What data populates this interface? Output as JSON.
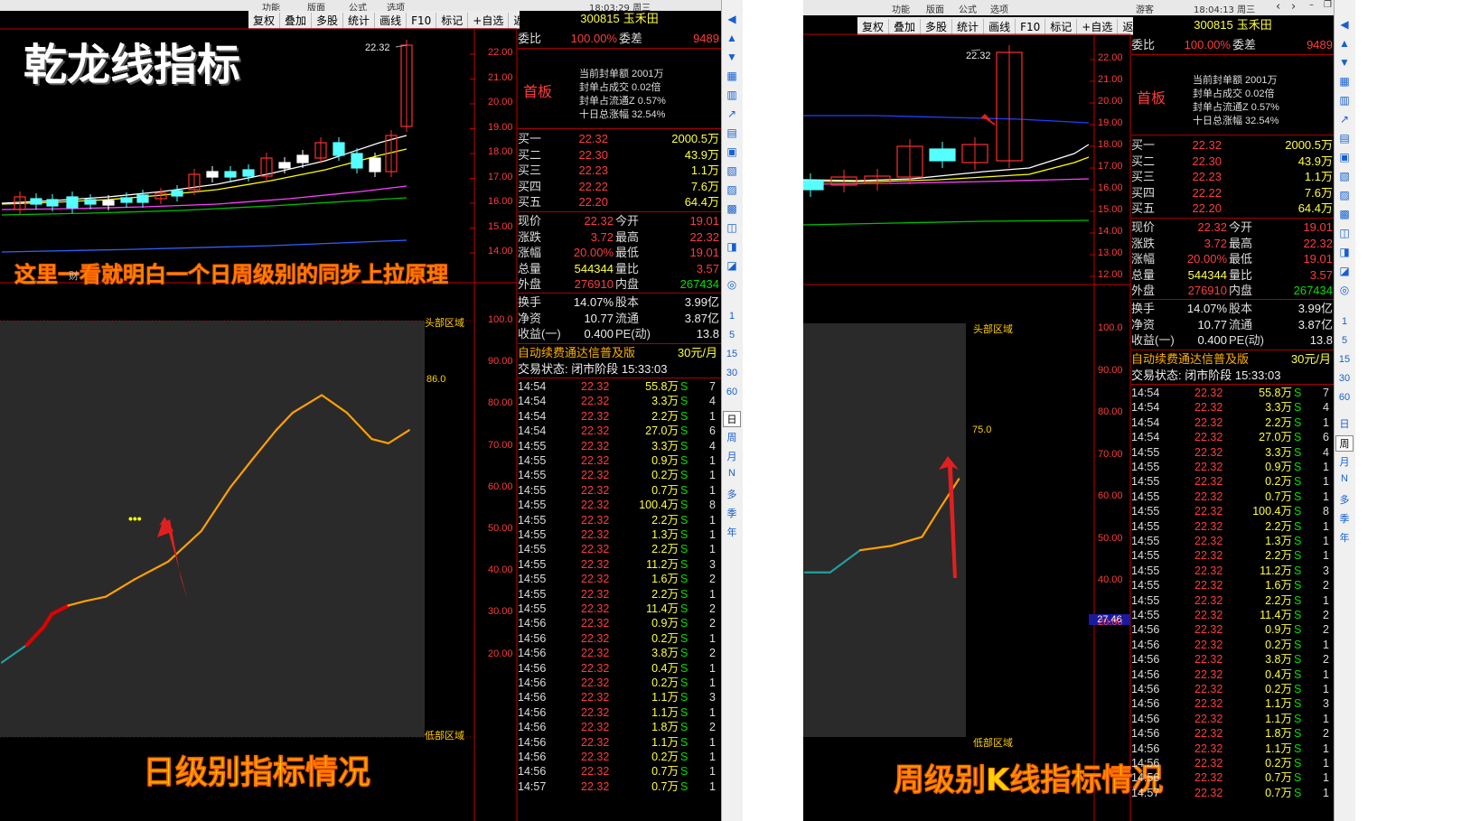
{
  "left": {
    "menu": [
      "功能",
      "版面",
      "公式",
      "选项"
    ],
    "time": "18:03:29 周三",
    "toolbar": [
      "复权",
      "叠加",
      "多股",
      "统计",
      "画线",
      "F10",
      "标记",
      "+自选",
      "返回"
    ],
    "overlay_title": "乾龙线指标",
    "overlay_caption": "这里一看就明白一个日周级别的同步上拉原理",
    "overlay_bottom": "日级别指标情况",
    "high_label": "22.32",
    "price_axis": [
      "22.00",
      "21.00",
      "20.00",
      "19.00",
      "18.00",
      "17.00",
      "16.00",
      "15.00",
      "14.00"
    ],
    "ind_axis": [
      "100.0",
      "90.00",
      "80.00",
      "70.00",
      "60.00",
      "50.00",
      "40.00",
      "30.00",
      "20.00"
    ],
    "top_zone": "头部区域",
    "bottom_zone": "低部区域",
    "ind_value": "86.0",
    "dots": "•••",
    "left_mark": "财",
    "indicator_points": [
      [
        0,
        27
      ],
      [
        6,
        31
      ],
      [
        10,
        35
      ],
      [
        12,
        38
      ],
      [
        16,
        40
      ],
      [
        20,
        41
      ],
      [
        25,
        42
      ],
      [
        32,
        46
      ],
      [
        40,
        50
      ],
      [
        48,
        57
      ],
      [
        55,
        67
      ],
      [
        60,
        73
      ],
      [
        66,
        80
      ],
      [
        70,
        84
      ],
      [
        77,
        88
      ],
      [
        83,
        84
      ],
      [
        89,
        78
      ],
      [
        93,
        77
      ],
      [
        98,
        80
      ]
    ]
  },
  "right": {
    "menu": [
      "功能",
      "版面",
      "公式",
      "选项"
    ],
    "guest": "游客",
    "time": "18:04:13 周三",
    "toolbar": [
      "复权",
      "叠加",
      "多股",
      "统计",
      "画线",
      "F10",
      "标记",
      "+自选",
      "返回"
    ],
    "overlay_bottom": "周级别K线指标情况",
    "high_label": "22.32",
    "price_axis": [
      "22.00",
      "21.00",
      "20.00",
      "19.00",
      "18.00",
      "17.00",
      "16.00",
      "15.00",
      "14.00",
      "13.00",
      "12.00"
    ],
    "ind_axis": [
      "100.0",
      "90.00",
      "80.00",
      "70.00",
      "60.00",
      "50.00",
      "40.00",
      "20.00"
    ],
    "cursor_value": "27.46",
    "top_zone": "头部区域",
    "bottom_zone": "低部区域",
    "ind_value": "75.0",
    "indicator_points": [
      [
        0,
        47
      ],
      [
        15,
        47
      ],
      [
        33,
        52
      ],
      [
        52,
        53
      ],
      [
        70,
        55
      ],
      [
        80,
        61
      ],
      [
        92,
        68
      ]
    ]
  },
  "quote": {
    "code": "300815",
    "name": "玉禾田",
    "weibi_label": "委比",
    "weibi_value": "100.00%",
    "weicha_label": "委差",
    "weicha_value": "9489",
    "first_board": "首板",
    "seal_lines": [
      "当前封单额 2001万",
      "封单占成交 0.02倍",
      "封单占流通Z 0.57%",
      "十日总涨幅 32.54%"
    ],
    "bids": [
      {
        "label": "买一",
        "price": "22.32",
        "vol": "2000.5万"
      },
      {
        "label": "买二",
        "price": "22.30",
        "vol": "43.9万"
      },
      {
        "label": "买三",
        "price": "22.23",
        "vol": "1.1万"
      },
      {
        "label": "买四",
        "price": "22.22",
        "vol": "7.6万"
      },
      {
        "label": "买五",
        "price": "22.20",
        "vol": "64.4万"
      }
    ],
    "stats": [
      {
        "l1": "现价",
        "v1": "22.32",
        "l2": "今开",
        "v2": "19.01"
      },
      {
        "l1": "涨跌",
        "v1": "3.72",
        "l2": "最高",
        "v2": "22.32"
      },
      {
        "l1": "涨幅",
        "v1": "20.00%",
        "l2": "最低",
        "v2": "19.01"
      },
      {
        "l1": "总量",
        "v1": "544344",
        "l2": "量比",
        "v2": "3.57"
      },
      {
        "l1": "外盘",
        "v1": "276910",
        "l2": "内盘",
        "v2": "267434"
      }
    ],
    "stats2": [
      {
        "l1": "换手",
        "v1": "14.07%",
        "l2": "股本",
        "v2": "3.99亿"
      },
      {
        "l1": "净资",
        "v1": "10.77",
        "l2": "流通",
        "v2": "3.87亿"
      },
      {
        "l1": "收益(一)",
        "v1": "0.400",
        "l2": "PE(动)",
        "v2": "13.8"
      }
    ],
    "ad": "自动续费通达信普及版",
    "ad_price": "30元/月",
    "trade_state": "交易状态: 闭市阶段 15:33:03",
    "ticks": [
      [
        "14:54",
        "22.32",
        "55.8万",
        "S",
        "7"
      ],
      [
        "14:54",
        "22.32",
        "3.3万",
        "S",
        "4"
      ],
      [
        "14:54",
        "22.32",
        "2.2万",
        "S",
        "1"
      ],
      [
        "14:54",
        "22.32",
        "27.0万",
        "S",
        "6"
      ],
      [
        "14:55",
        "22.32",
        "3.3万",
        "S",
        "4"
      ],
      [
        "14:55",
        "22.32",
        "0.9万",
        "S",
        "1"
      ],
      [
        "14:55",
        "22.32",
        "0.2万",
        "S",
        "1"
      ],
      [
        "14:55",
        "22.32",
        "0.7万",
        "S",
        "1"
      ],
      [
        "14:55",
        "22.32",
        "100.4万",
        "S",
        "8"
      ],
      [
        "14:55",
        "22.32",
        "2.2万",
        "S",
        "1"
      ],
      [
        "14:55",
        "22.32",
        "1.3万",
        "S",
        "1"
      ],
      [
        "14:55",
        "22.32",
        "2.2万",
        "S",
        "1"
      ],
      [
        "14:55",
        "22.32",
        "11.2万",
        "S",
        "3"
      ],
      [
        "14:55",
        "22.32",
        "1.6万",
        "S",
        "2"
      ],
      [
        "14:55",
        "22.32",
        "2.2万",
        "S",
        "1"
      ],
      [
        "14:55",
        "22.32",
        "11.4万",
        "S",
        "2"
      ],
      [
        "14:56",
        "22.32",
        "0.9万",
        "S",
        "2"
      ],
      [
        "14:56",
        "22.32",
        "0.2万",
        "S",
        "1"
      ],
      [
        "14:56",
        "22.32",
        "3.8万",
        "S",
        "2"
      ],
      [
        "14:56",
        "22.32",
        "0.4万",
        "S",
        "1"
      ],
      [
        "14:56",
        "22.32",
        "0.2万",
        "S",
        "1"
      ],
      [
        "14:56",
        "22.32",
        "1.1万",
        "S",
        "3"
      ],
      [
        "14:56",
        "22.32",
        "1.1万",
        "S",
        "1"
      ],
      [
        "14:56",
        "22.32",
        "1.8万",
        "S",
        "2"
      ],
      [
        "14:56",
        "22.32",
        "1.1万",
        "S",
        "1"
      ],
      [
        "14:56",
        "22.32",
        "0.2万",
        "S",
        "1"
      ],
      [
        "14:56",
        "22.32",
        "0.7万",
        "S",
        "1"
      ],
      [
        "14:57",
        "22.32",
        "0.7万",
        "S",
        "1"
      ]
    ]
  },
  "side_buttons": [
    "1",
    "5",
    "15",
    "30",
    "60",
    "日",
    "周",
    "月",
    "N",
    "多",
    "季",
    "年"
  ],
  "colors": {
    "red": "#ff3c3c",
    "yellow": "#ffff40",
    "green": "#00e000",
    "cyan": "#33ddff",
    "orange": "#ffa500"
  }
}
